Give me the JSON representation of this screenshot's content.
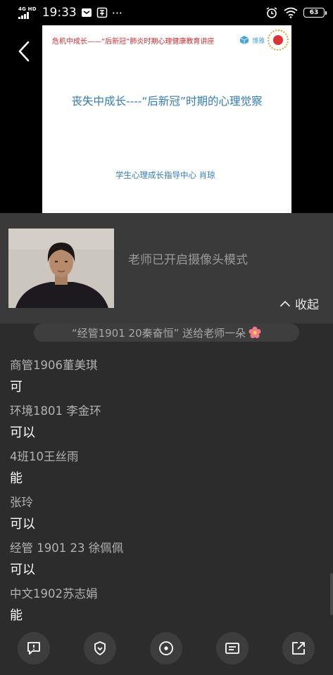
{
  "status_bar": {
    "network": "4G HD",
    "time": "19:33",
    "more": "···",
    "battery": "63"
  },
  "slide": {
    "header": "危机中成长——“后新冠”肺炎时期心理健康教育讲座",
    "logo_text": "博雅",
    "title": "丧失中成长----“后新冠”时期的心理觉察",
    "subtitle": "学生心理成长指导中心    肖琼"
  },
  "camera": {
    "status_text": "老师已开启摄像头模式",
    "collapse_label": "收起"
  },
  "chat": {
    "gift_banner": "“经管1901 20秦奋恒” 送给老师一朵",
    "messages": [
      {
        "sender": "商管1906董美琪",
        "text": "可"
      },
      {
        "sender": "环境1801 李金环",
        "text": "可以"
      },
      {
        "sender": "4班10王丝雨",
        "text": "能"
      },
      {
        "sender": "张玲",
        "text": "可以"
      },
      {
        "sender": "经管 1901 23 徐佩佩",
        "text": "可以"
      },
      {
        "sender": "中文1902苏志娟",
        "text": "能"
      }
    ]
  },
  "toolbar": {
    "buttons": [
      "chat-icon",
      "shield-icon",
      "target-icon",
      "card-icon",
      "share-icon"
    ]
  },
  "colors": {
    "background": "#2c2c2c",
    "panel": "#3a3a3a",
    "slide_title": "#2f7bbd",
    "slide_header": "#d42a2a"
  }
}
